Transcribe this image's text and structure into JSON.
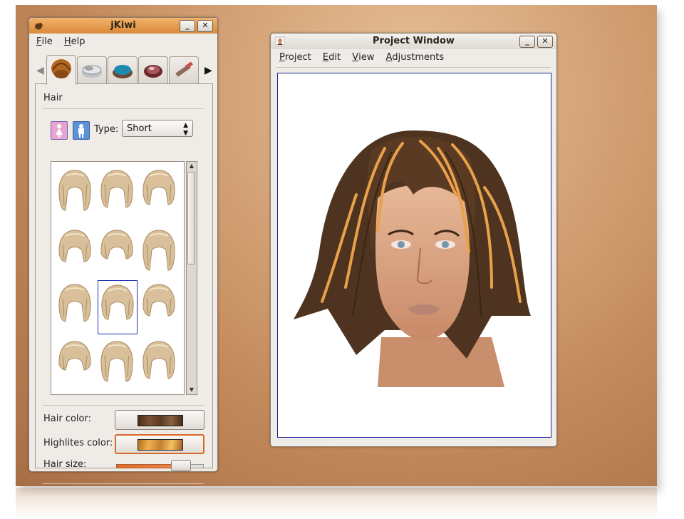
{
  "jkiwi": {
    "title": "jKiwi",
    "menu": [
      {
        "label": "File",
        "underline": "F",
        "rest": "ile"
      },
      {
        "label": "Help",
        "underline": "H",
        "rest": "elp"
      }
    ],
    "tabs": [
      "hair-tab",
      "powder-tab",
      "eyeshadow-tab",
      "blush-tab",
      "lipstick-tab"
    ],
    "section_title": "Hair",
    "type_label": "Type:",
    "type_value": "Short",
    "hair_color_label": "Hair color:",
    "highlites_color_label": "Highlites color:",
    "hair_size_label": "Hair size:",
    "hair_size_level": 0.66,
    "hairstyles_count": 12,
    "selected_index": 7
  },
  "project": {
    "title": "Project Window",
    "menu": [
      {
        "label": "Project",
        "underline": "P",
        "rest": "roject"
      },
      {
        "label": "Edit",
        "underline": "E",
        "rest": "dit"
      },
      {
        "label": "View",
        "underline": "V",
        "rest": "iew"
      },
      {
        "label": "Adjustments",
        "underline": "A",
        "rest": "djustments"
      }
    ]
  },
  "colors": {
    "accent": "#e07a34",
    "selection": "#1a2cb0",
    "hair_dark": "#5a3a22",
    "hair_highlight": "#e8a24a"
  }
}
